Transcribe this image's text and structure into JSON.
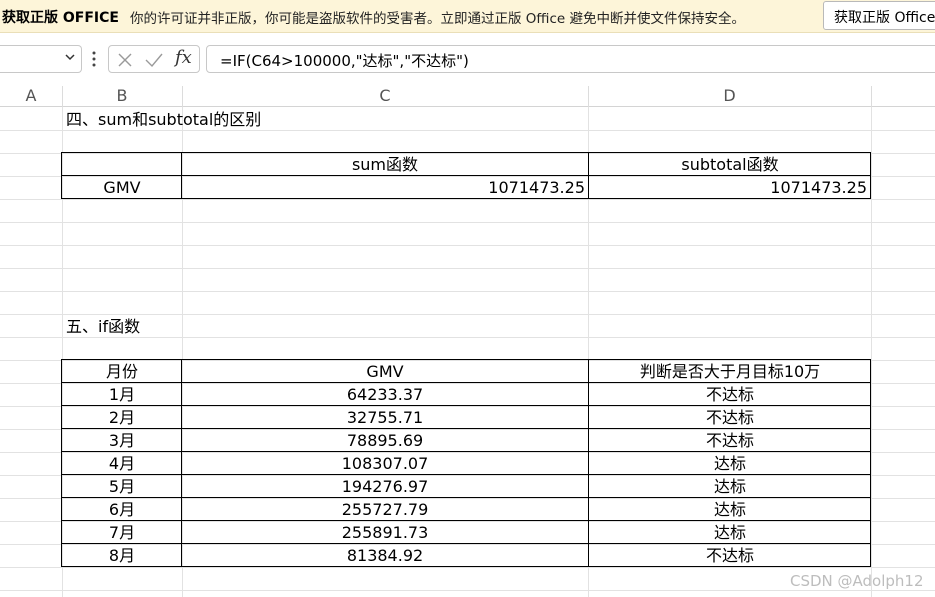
{
  "banner": {
    "title": "获取正版 OFFICE",
    "message": "你的许可证并非正版，你可能是盗版软件的受害者。立即通过正版 Office 避免中断并使文件保持安全。",
    "button": "获取正版 Office"
  },
  "formula_bar": {
    "namebox_value": "",
    "formula": "=IF(C64>100000,\"达标\",\"不达标\")",
    "fx_label": "fx"
  },
  "columns": [
    "A",
    "B",
    "C",
    "D"
  ],
  "section4": {
    "title": "四、sum和subtotal的区别",
    "headers": [
      "",
      "sum函数",
      "subtotal函数"
    ],
    "row": {
      "label": "GMV",
      "sum": "1071473.25",
      "subtotal": "1071473.25"
    }
  },
  "section5": {
    "title": "五、if函数",
    "headers": [
      "月份",
      "GMV",
      "判断是否大于月目标10万"
    ],
    "rows": [
      {
        "month": "1月",
        "gmv": "64233.37",
        "result": "不达标"
      },
      {
        "month": "2月",
        "gmv": "32755.71",
        "result": "不达标"
      },
      {
        "month": "3月",
        "gmv": "78895.69",
        "result": "不达标"
      },
      {
        "month": "4月",
        "gmv": "108307.07",
        "result": "达标"
      },
      {
        "month": "5月",
        "gmv": "194276.97",
        "result": "达标"
      },
      {
        "month": "6月",
        "gmv": "255727.79",
        "result": "达标"
      },
      {
        "month": "7月",
        "gmv": "255891.73",
        "result": "达标"
      },
      {
        "month": "8月",
        "gmv": "81384.92",
        "result": "不达标"
      }
    ]
  },
  "watermark": "CSDN @Adolph12"
}
